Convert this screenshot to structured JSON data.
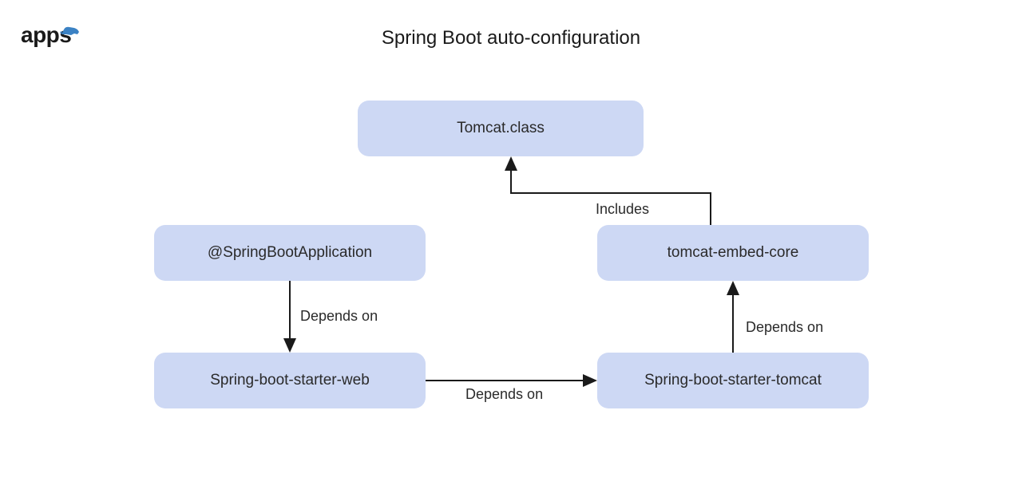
{
  "logo": "apps",
  "title": "Spring Boot auto-configuration",
  "boxes": {
    "tomcatClass": "Tomcat.class",
    "springBootApp": "@SpringBootApplication",
    "tomcatEmbed": "tomcat-embed-core",
    "starterWeb": "Spring-boot-starter-web",
    "starterTomcat": "Spring-boot-starter-tomcat"
  },
  "labels": {
    "dependsOn1": "Depends on",
    "dependsOn2": "Depends on",
    "dependsOn3": "Depends on",
    "includes": "Includes"
  },
  "colors": {
    "boxBg": "#cdd8f4",
    "text": "#2a2a2a",
    "accent": "#3b82c4"
  }
}
